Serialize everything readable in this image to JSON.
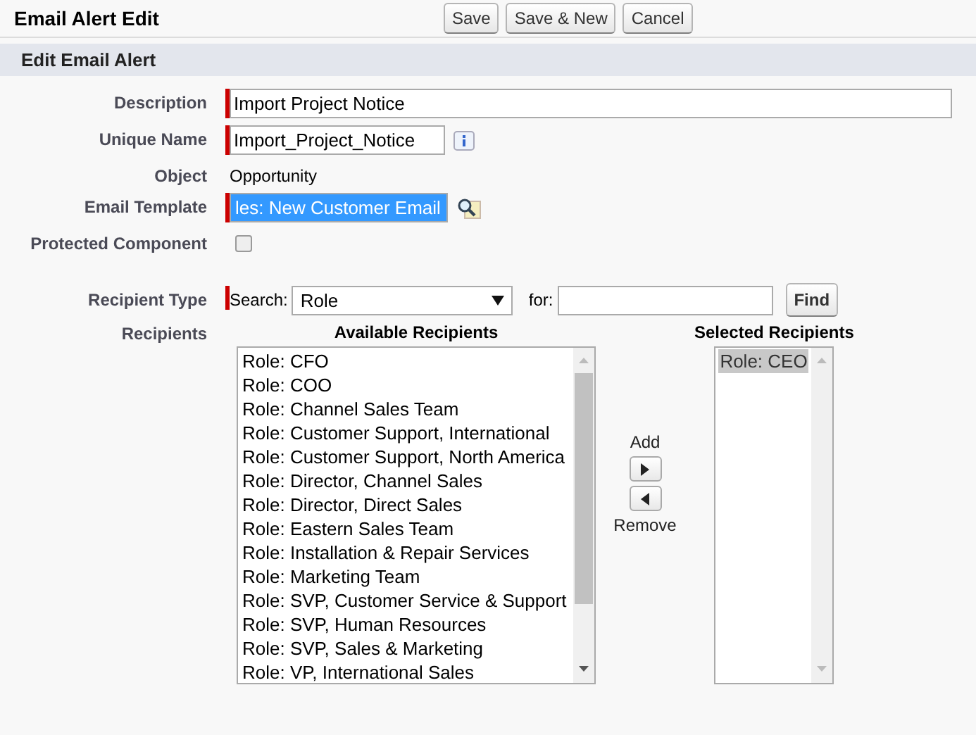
{
  "header": {
    "title": "Email Alert Edit",
    "buttons": [
      "Save",
      "Save & New",
      "Cancel"
    ]
  },
  "section": {
    "title": "Edit Email Alert"
  },
  "fields": [
    {
      "kind": "text",
      "label": "Description",
      "required": true,
      "value": "Import Project Notice"
    },
    {
      "kind": "text_info",
      "label": "Unique Name",
      "required": true,
      "value": "Import_Project_Notice"
    },
    {
      "kind": "static",
      "label": "Object",
      "required": false,
      "value": "Opportunity"
    },
    {
      "kind": "lookup",
      "label": "Email Template",
      "required": true,
      "value": "les: New Customer Email",
      "selected": true
    },
    {
      "kind": "checkbox",
      "label": "Protected Component",
      "required": false,
      "checked": false
    }
  ],
  "recipient_type": {
    "label": "Recipient Type",
    "required": true,
    "search_label": "Search:",
    "search_value": "Role",
    "for_label": "for:",
    "find_button": "Find"
  },
  "recipients": {
    "label": "Recipients",
    "add_label": "Add",
    "remove_label": "Remove",
    "available": {
      "title": "Available Recipients",
      "items": [
        {
          "label": "Role: CFO",
          "selected": false
        },
        {
          "label": "Role: COO",
          "selected": false
        },
        {
          "label": "Role: Channel Sales Team",
          "selected": false
        },
        {
          "label": "Role: Customer Support, International",
          "selected": false
        },
        {
          "label": "Role: Customer Support, North America",
          "selected": false
        },
        {
          "label": "Role: Director, Channel Sales",
          "selected": false
        },
        {
          "label": "Role: Director, Direct Sales",
          "selected": false
        },
        {
          "label": "Role: Eastern Sales Team",
          "selected": false
        },
        {
          "label": "Role: Installation & Repair Services",
          "selected": false
        },
        {
          "label": "Role: Marketing Team",
          "selected": false
        },
        {
          "label": "Role: SVP, Customer Service & Support",
          "selected": false
        },
        {
          "label": "Role: SVP, Human Resources",
          "selected": false
        },
        {
          "label": "Role: SVP, Sales & Marketing",
          "selected": false
        },
        {
          "label": "Role: VP, International Sales",
          "selected": false
        }
      ]
    },
    "selected": {
      "title": "Selected Recipients",
      "items": [
        {
          "label": "Role: CEO",
          "selected": true
        }
      ]
    }
  }
}
